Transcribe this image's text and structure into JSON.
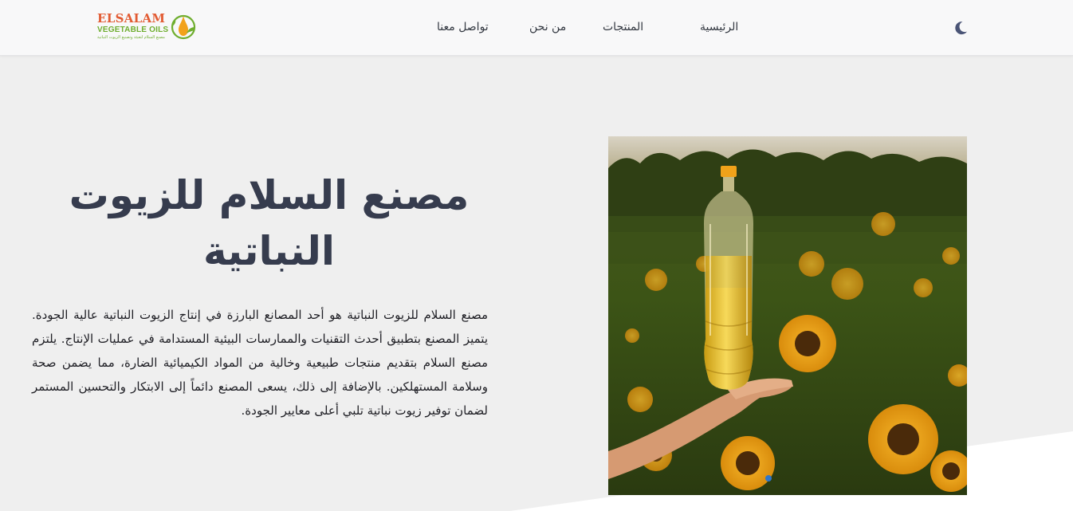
{
  "nav": {
    "logo_text": "ELSALAM",
    "logo_subtext": "VEGETABLE OILS",
    "logo_tagline": "مصنع السلام لتعبئة وتصنيع الزيوت النباتية",
    "links": [
      {
        "label": "الرئيسية"
      },
      {
        "label": "المنتجات"
      },
      {
        "label": "من نحن"
      },
      {
        "label": "تواصل معنا"
      }
    ],
    "theme_icon": "moon-icon"
  },
  "hero": {
    "title": "مصنع السلام للزيوت النباتية",
    "description": "مصنع السلام للزيوت النباتية هو أحد المصانع البارزة في إنتاج الزيوت النباتية عالية الجودة. يتميز المصنع بتطبيق أحدث التقنيات والممارسات البيئية المستدامة في عمليات الإنتاج. يلتزم مصنع السلام بتقديم منتجات طبيعية وخالية من المواد الكيميائية الضارة، مما يضمن صحة وسلامة المستهلكين. بالإضافة إلى ذلك، يسعى المصنع دائماً إلى الابتكار والتحسين المستمر لضمان توفير زيوت نباتية تلبي أعلى معايير الجودة.",
    "image": "sunflower-oil-bottle-photo"
  },
  "colors": {
    "accent_orange": "#e25b33",
    "accent_green": "#6fae2f",
    "title": "#363c4e",
    "moon": "#4a5476"
  }
}
